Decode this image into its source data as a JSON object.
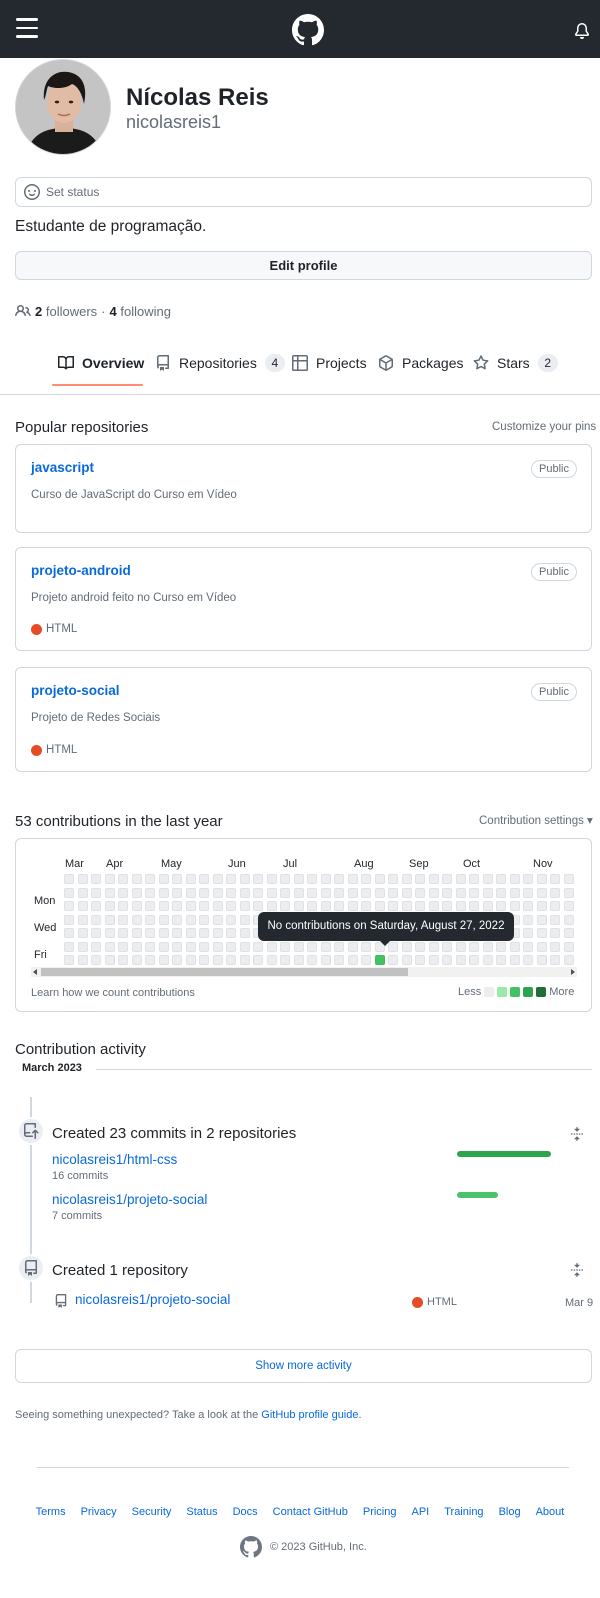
{
  "profile": {
    "name": "Nícolas Reis",
    "login": "nicolasreis1",
    "status_placeholder": "Set status",
    "bio": "Estudante de programação.",
    "edit_label": "Edit profile",
    "followers_count": "2",
    "followers_label": "followers",
    "separator": "·",
    "following_count": "4",
    "following_label": "following"
  },
  "tabs": [
    {
      "label": "Overview",
      "icon": "book-icon",
      "active": true
    },
    {
      "label": "Repositories",
      "icon": "repo-icon",
      "count": "4"
    },
    {
      "label": "Projects",
      "icon": "table-icon"
    },
    {
      "label": "Packages",
      "icon": "package-icon"
    },
    {
      "label": "Stars",
      "icon": "star-icon",
      "count": "2"
    }
  ],
  "popular": {
    "title": "Popular repositories",
    "customize": "Customize your pins",
    "repos": [
      {
        "name": "javascript",
        "visibility": "Public",
        "description": "Curso de JavaScript do Curso em Vídeo",
        "language": ""
      },
      {
        "name": "projeto-android",
        "visibility": "Public",
        "description": "Projeto android feito no Curso em Vídeo",
        "language": "HTML"
      },
      {
        "name": "projeto-social",
        "visibility": "Public",
        "description": "Projeto de Redes Sociais",
        "language": "HTML"
      }
    ],
    "language_color": "#e34c26"
  },
  "contributions": {
    "title": "53 contributions in the last year",
    "settings": "Contribution settings ▾",
    "months": [
      "Mar",
      "Apr",
      "May",
      "Jun",
      "Jul",
      "Aug",
      "Sep",
      "Oct",
      "Nov"
    ],
    "days": [
      "Mon",
      "Wed",
      "Fri"
    ],
    "tooltip": "No contributions on Saturday, August 27, 2022",
    "learn": "Learn how we count contributions",
    "less": "Less",
    "more": "More",
    "legend_colors": [
      "#ebedf0",
      "#9be9a8",
      "#40c463",
      "#30a14e",
      "#216e39"
    ]
  },
  "activity": {
    "title": "Contribution activity",
    "month": "March 2023",
    "commits": {
      "title": "Created 23 commits in 2 repositories",
      "repos": [
        {
          "name": "nicolasreis1/html-css",
          "count": "16 commits",
          "share": 0.7
        },
        {
          "name": "nicolasreis1/projeto-social",
          "count": "7 commits",
          "share": 0.3
        }
      ]
    },
    "created": {
      "title": "Created 1 repository",
      "repo": "nicolasreis1/projeto-social",
      "language": "HTML",
      "date": "Mar 9"
    },
    "show_more": "Show more activity",
    "unexpected_text": "Seeing something unexpected? Take a look at the",
    "guide_link": "GitHub profile guide",
    "guide_suffix": "."
  },
  "footer": {
    "links": [
      "Terms",
      "Privacy",
      "Security",
      "Status",
      "Docs",
      "Contact GitHub",
      "Pricing",
      "API",
      "Training",
      "Blog",
      "About"
    ],
    "copyright": "© 2023 GitHub, Inc."
  }
}
